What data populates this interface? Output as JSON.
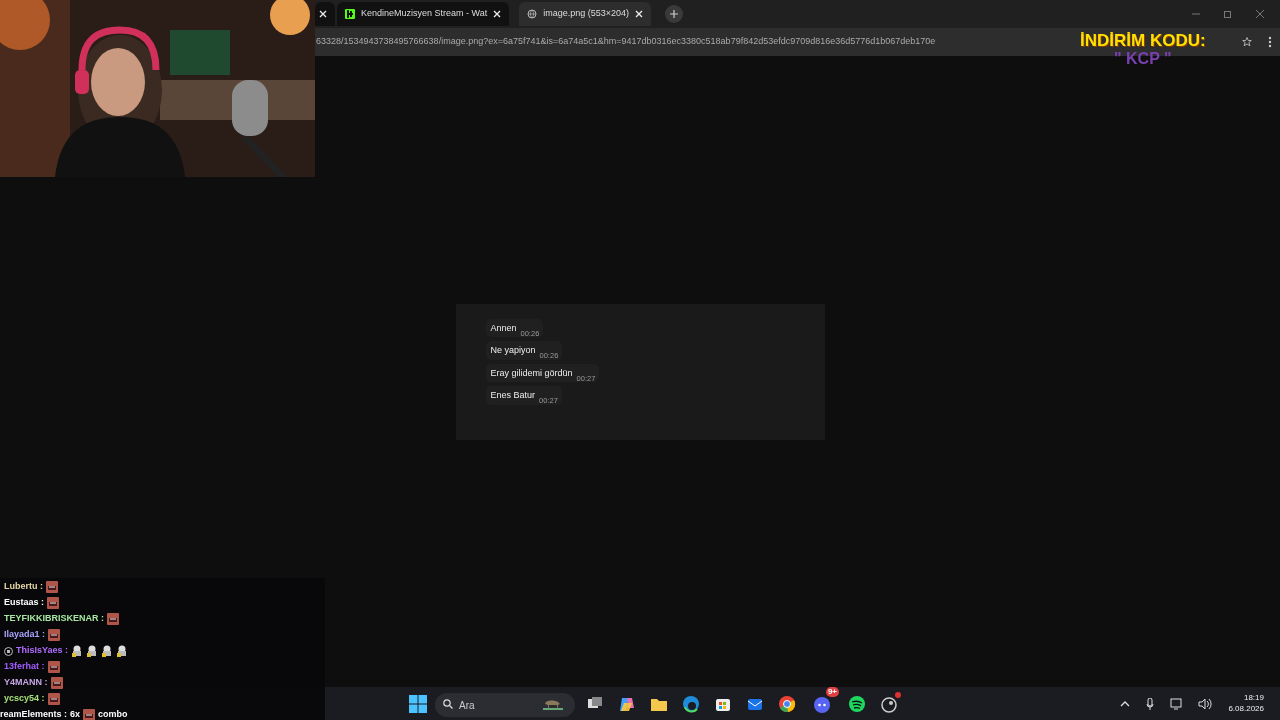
{
  "browser": {
    "tabs": [
      {
        "selected": false
      },
      {
        "label": "KendineMuzisyen Stream - Wat",
        "selected": false
      },
      {
        "label": "image.png (553×204)",
        "selected": true
      }
    ],
    "url": "63328/1534943738495766638/image.png?ex=6a75f741&is=6a74a5c1&hm=9417db0316ec3380c518ab79f842d53efdc9709d816e36d5776d1b067deb170e"
  },
  "promo": {
    "title": "İNDİRİM KODU:",
    "code": "\" KCP \""
  },
  "messages": [
    {
      "text": "Annen",
      "time": "00:26"
    },
    {
      "text": "Ne yapiyon",
      "time": "00:26"
    },
    {
      "text": "Eray gilidemi gördün",
      "time": "00:27"
    },
    {
      "text": "Enes Batur",
      "time": "00:27"
    }
  ],
  "chat": [
    {
      "user": "Lubertu :",
      "color": "#e6d7a6",
      "emotes": [
        {
          "kind": "face"
        }
      ]
    },
    {
      "user": "Eustaas :",
      "color": "#ffffff",
      "emotes": [
        {
          "kind": "face"
        }
      ]
    },
    {
      "user": "TEYFIKKIBRISKENAR :",
      "color": "#a6e8a0",
      "emotes": [
        {
          "kind": "face"
        }
      ]
    },
    {
      "user": "Ilayada1 :",
      "color": "#a9a4ff",
      "emotes": [
        {
          "kind": "face"
        }
      ]
    },
    {
      "user": "ThisIsYaes :",
      "color": "#b06cff",
      "badge": true,
      "emotes": [
        {
          "kind": "figure"
        },
        {
          "kind": "figure"
        },
        {
          "kind": "figure"
        },
        {
          "kind": "figure"
        }
      ]
    },
    {
      "user": "13ferhat :",
      "color": "#a35cff",
      "emotes": [
        {
          "kind": "face"
        }
      ]
    },
    {
      "user": "Y4MANN :",
      "color": "#c9a6e6",
      "emotes": [
        {
          "kind": "face"
        }
      ]
    },
    {
      "user": "ycscy54 :",
      "color": "#a6e07a",
      "emotes": [
        {
          "kind": "face"
        }
      ]
    }
  ],
  "combo": {
    "user": "reamElements :",
    "count": "6x",
    "label": "combo"
  },
  "taskbar": {
    "search": {
      "placeholder": "Ara"
    },
    "discord_badge": "9+",
    "time": "18:19",
    "date": "6.08.2026"
  }
}
